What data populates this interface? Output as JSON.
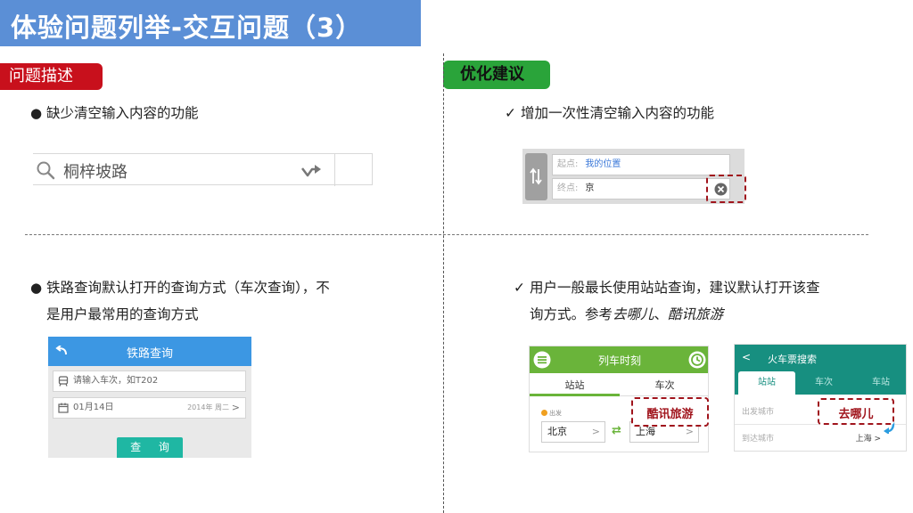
{
  "slide": {
    "title": "体验问题列举-交互问题（3）"
  },
  "tags": {
    "problem": "问题描述",
    "suggestion": "优化建议"
  },
  "issue1": {
    "bullet_mark": "●",
    "text": "缺少清空输入内容的功能",
    "search_text": "桐梓坡路"
  },
  "suggest1": {
    "check_mark": "✓",
    "text": "增加一次性清空输入内容的功能",
    "start_label": "起点:",
    "start_value": "我的位置",
    "end_label": "终点:",
    "end_value": "京"
  },
  "issue2": {
    "bullet_mark": "●",
    "line1": "铁路查询默认打开的查询方式（车次查询），不",
    "line2": "是用户最常用的查询方式",
    "app_title": "铁路查询",
    "train_placeholder": "请输入车次，如T202",
    "date": "01月14日",
    "date_right": "2014年 周二",
    "date_chevron": ">",
    "query_button": "查 询"
  },
  "suggest2": {
    "check_mark": "✓",
    "line1": "用户一般最长使用站站查询，建议默认打开该查",
    "line2_prefix": "询方式。参考",
    "ref1": "去哪儿",
    "sep": "、",
    "ref2": "酷讯旅游"
  },
  "schedule_app": {
    "title": "列车时刻",
    "tab_station": "站站",
    "tab_train": "车次",
    "from_label": "出发",
    "from_city": "北京",
    "to_city": "上海",
    "chevron": ">",
    "swap": "⇄",
    "highlight_label": "酷讯旅游"
  },
  "ticket_app": {
    "back": "<",
    "title": "火车票搜索",
    "tab_station": "站站",
    "tab_train": "车次",
    "tab_stop": "车站",
    "from_label": "出发城市",
    "to_label": "到达城市",
    "to_value": "上海 >",
    "highlight_label": "去哪儿"
  },
  "colors": {
    "title_bg": "#5b8fd6",
    "problem_tag": "#c8101c",
    "suggest_tag": "#2aa43a",
    "highlight_border": "#a0141c"
  }
}
